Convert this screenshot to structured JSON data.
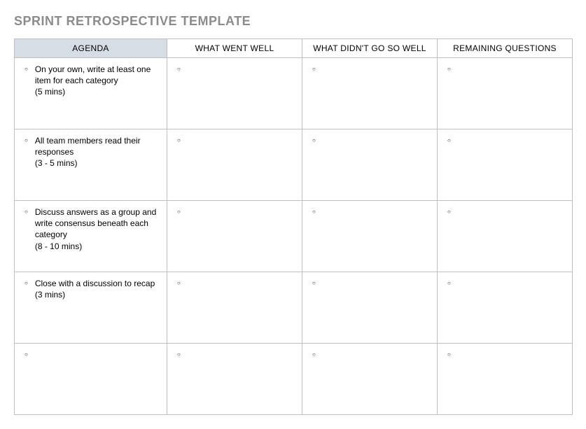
{
  "title": "SPRINT RETROSPECTIVE TEMPLATE",
  "headers": {
    "agenda": "AGENDA",
    "went_well": "WHAT WENT WELL",
    "not_well": "WHAT DIDN'T GO SO WELL",
    "remaining": "REMAINING QUESTIONS"
  },
  "rows": [
    {
      "agenda_text": "On your own, write at least one item for each category",
      "agenda_duration": "(5 mins)",
      "went_well": "",
      "not_well": "",
      "remaining": ""
    },
    {
      "agenda_text": "All team members read their responses",
      "agenda_duration": "(3 - 5 mins)",
      "went_well": "",
      "not_well": "",
      "remaining": ""
    },
    {
      "agenda_text": "Discuss answers as a group and write consensus beneath each category",
      "agenda_duration": "(8 - 10 mins)",
      "went_well": "",
      "not_well": "",
      "remaining": ""
    },
    {
      "agenda_text": "Close with a discussion to recap",
      "agenda_duration": "(3 mins)",
      "went_well": "",
      "not_well": "",
      "remaining": ""
    },
    {
      "agenda_text": "",
      "agenda_duration": "",
      "went_well": "",
      "not_well": "",
      "remaining": ""
    }
  ]
}
